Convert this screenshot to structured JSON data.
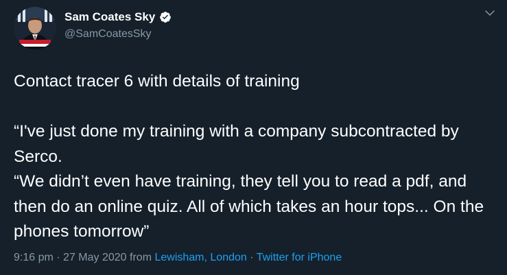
{
  "author": {
    "display_name": "Sam Coates Sky",
    "handle": "@SamCoatesSky",
    "verified": true,
    "avatar_icon": "avatar-photo"
  },
  "tweet": {
    "text": "Contact tracer 6 with details of training\n\n“I've just done my training with a company subcontracted by Serco.\n“We didn’t even have training, they tell you to read a pdf, and then do an online quiz. All of which takes an hour tops... On the phones tomorrow”",
    "time": "9:16 pm",
    "date": "27 May 2020",
    "from_label": "from",
    "location": "Lewisham, London",
    "source": "Twitter for iPhone",
    "separator": "·"
  },
  "ui": {
    "menu_icon": "chevron-down-icon"
  },
  "colors": {
    "background": "#15202b",
    "text": "#ffffff",
    "muted": "#8899a6",
    "link": "#1da1f2",
    "verified_badge": "#ffffff"
  }
}
